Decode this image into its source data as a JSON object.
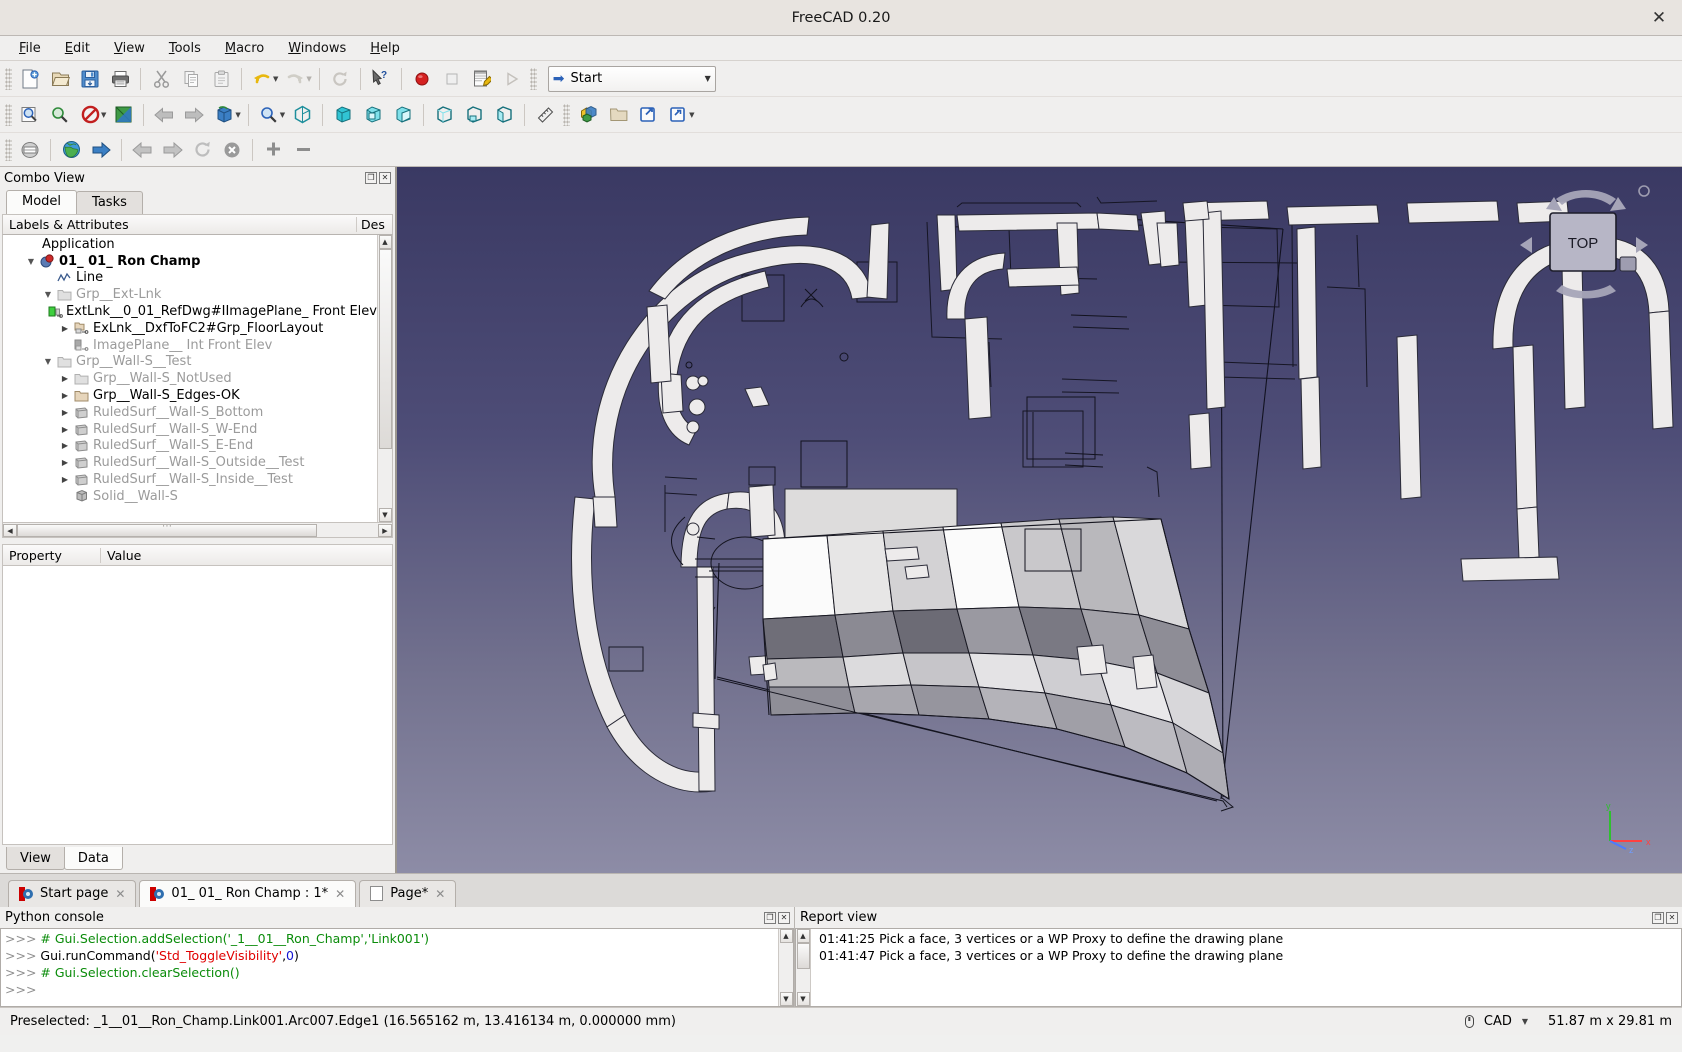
{
  "window": {
    "title": "FreeCAD 0.20",
    "close_label": "✕"
  },
  "menubar": {
    "items": [
      {
        "label": "File",
        "mnemonic": "F"
      },
      {
        "label": "Edit",
        "mnemonic": "E"
      },
      {
        "label": "View",
        "mnemonic": "V"
      },
      {
        "label": "Tools",
        "mnemonic": "T"
      },
      {
        "label": "Macro",
        "mnemonic": "M"
      },
      {
        "label": "Windows",
        "mnemonic": "W"
      },
      {
        "label": "Help",
        "mnemonic": "H"
      }
    ]
  },
  "toolbars": {
    "file": [
      "new-document-icon",
      "open-document-icon",
      "save-document-icon",
      "print-icon",
      "cut-icon",
      "copy-icon",
      "paste-icon",
      "undo-icon",
      "redo-icon",
      "refresh-icon",
      "whats-this-icon",
      "macro-record-icon",
      "macro-stop-icon",
      "macro-edit-icon",
      "macro-execute-icon"
    ],
    "workbench_selector": {
      "value": "Start"
    },
    "view": [
      "fit-all-icon",
      "fit-selection-icon",
      "draw-style-icon",
      "clipping-icon",
      "nav-back-icon",
      "nav-forward-icon",
      "view-rotate-icon",
      "zoom-box-icon",
      "axonometric-icon",
      "front-view-icon",
      "top-view-icon",
      "right-view-icon",
      "rear-view-icon",
      "bottom-view-icon",
      "left-view-icon",
      "measure-icon",
      "part-icon",
      "folder-icon",
      "link-icon",
      "link-group-icon"
    ],
    "start": [
      "start-workbench-icon",
      "web-home-icon",
      "web-go-icon",
      "web-back-icon",
      "web-forward-icon",
      "web-refresh-icon",
      "web-stop-icon",
      "zoom-in-icon",
      "zoom-out-icon"
    ]
  },
  "combo_view": {
    "title": "Combo View",
    "tabs": [
      {
        "label": "Model",
        "active": true
      },
      {
        "label": "Tasks",
        "active": false
      }
    ],
    "tree_header": {
      "col1": "Labels & Attributes",
      "col2": "Des"
    },
    "tree": [
      {
        "label": "Application",
        "indent": 0,
        "icon": "none",
        "expander": "",
        "state": "normal"
      },
      {
        "label": "01_ 01_ Ron Champ",
        "indent": 1,
        "icon": "document-icon",
        "expander": "open",
        "state": "bold"
      },
      {
        "label": "Line",
        "indent": 2,
        "icon": "polyline-icon",
        "expander": "",
        "state": "normal"
      },
      {
        "label": "Grp__Ext-Lnk",
        "indent": 2,
        "icon": "folder-gray-icon",
        "expander": "open",
        "state": "dim"
      },
      {
        "label": "ExtLnk__0_01_RefDwg#IImagePlane_ Front Elev",
        "indent": 3,
        "icon": "link-green-icon",
        "expander": "",
        "state": "normal"
      },
      {
        "label": "ExLnk__DxfToFC2#Grp_FloorLayout",
        "indent": 3,
        "icon": "link-folder-icon",
        "expander": "closed",
        "state": "normal"
      },
      {
        "label": "ImagePlane__ Int Front Elev",
        "indent": 3,
        "icon": "link-gray-icon",
        "expander": "",
        "state": "dim"
      },
      {
        "label": "Grp__Wall-S__Test",
        "indent": 2,
        "icon": "folder-gray-icon",
        "expander": "open",
        "state": "dim"
      },
      {
        "label": "Grp__Wall-S_NotUsed",
        "indent": 3,
        "icon": "folder-gray-icon",
        "expander": "closed",
        "state": "dim"
      },
      {
        "label": "Grp__Wall-S_Edges-OK",
        "indent": 3,
        "icon": "folder-tan-icon",
        "expander": "closed",
        "state": "normal"
      },
      {
        "label": "RuledSurf__Wall-S_Bottom",
        "indent": 3,
        "icon": "surface-icon",
        "expander": "closed",
        "state": "dim"
      },
      {
        "label": "RuledSurf__Wall-S_W-End",
        "indent": 3,
        "icon": "surface-icon",
        "expander": "closed",
        "state": "dim"
      },
      {
        "label": "RuledSurf__Wall-S_E-End",
        "indent": 3,
        "icon": "surface-icon",
        "expander": "closed",
        "state": "dim"
      },
      {
        "label": "RuledSurf__Wall-S_Outside__Test",
        "indent": 3,
        "icon": "surface-icon",
        "expander": "closed",
        "state": "dim"
      },
      {
        "label": "RuledSurf__Wall-S_Inside__Test",
        "indent": 3,
        "icon": "surface-icon",
        "expander": "closed",
        "state": "dim"
      },
      {
        "label": "Solid__Wall-S",
        "indent": 3,
        "icon": "solid-icon",
        "expander": "",
        "state": "dim"
      }
    ],
    "property_header": {
      "col1": "Property",
      "col2": "Value"
    },
    "property_rows": [],
    "bottom_tabs": [
      {
        "label": "View",
        "active": false
      },
      {
        "label": "Data",
        "active": true
      }
    ]
  },
  "view3d": {
    "nav_cube_label": "TOP",
    "axis": {
      "x": "x",
      "y": "y",
      "z": "z"
    }
  },
  "view_tabs": [
    {
      "label": "Start page",
      "icon": "freecad-icon",
      "active": false,
      "close": "✕"
    },
    {
      "label": "01_ 01_ Ron Champ : 1*",
      "icon": "freecad-icon",
      "active": true,
      "close": "✕"
    },
    {
      "label": "Page*",
      "icon": "page-icon",
      "active": false,
      "close": "✕"
    }
  ],
  "python_console": {
    "title": "Python console",
    "lines": [
      {
        "prompt": ">>>",
        "segments": [
          {
            "t": "# Gui.Selection.addSelection('_1__01__Ron_Champ','Link001')",
            "c": "cmt"
          }
        ]
      },
      {
        "prompt": ">>>",
        "segments": [
          {
            "t": "Gui.runCommand(",
            "c": "plain"
          },
          {
            "t": "'Std_ToggleVisibility'",
            "c": "str"
          },
          {
            "t": ",",
            "c": "plain"
          },
          {
            "t": "0",
            "c": "num"
          },
          {
            "t": ")",
            "c": "plain"
          }
        ]
      },
      {
        "prompt": ">>>",
        "segments": [
          {
            "t": "# Gui.Selection.clearSelection()",
            "c": "cmt"
          }
        ]
      },
      {
        "prompt": ">>>",
        "segments": []
      }
    ]
  },
  "report_view": {
    "title": "Report view",
    "lines": [
      "01:41:25  Pick a face, 3 vertices or a WP Proxy to define the drawing plane",
      "01:41:47  Pick a face, 3 vertices or a WP Proxy to define the drawing plane"
    ]
  },
  "status_bar": {
    "message": "Preselected: _1__01__Ron_Champ.Link001.Arc007.Edge1 (16.565162 m, 13.416134 m, 0.000000 mm)",
    "nav_style": "CAD",
    "dimensions": "51.87 m x 29.81 m"
  },
  "colors": {
    "accent_blue": "#2c62b8",
    "view_bg_top": "#3a3963",
    "view_bg_bottom": "#8d8ca6",
    "wall_white": "#eceaea",
    "comment_green": "#0b8c0b",
    "string_red": "#e00000",
    "number_blue": "#1414d2"
  }
}
